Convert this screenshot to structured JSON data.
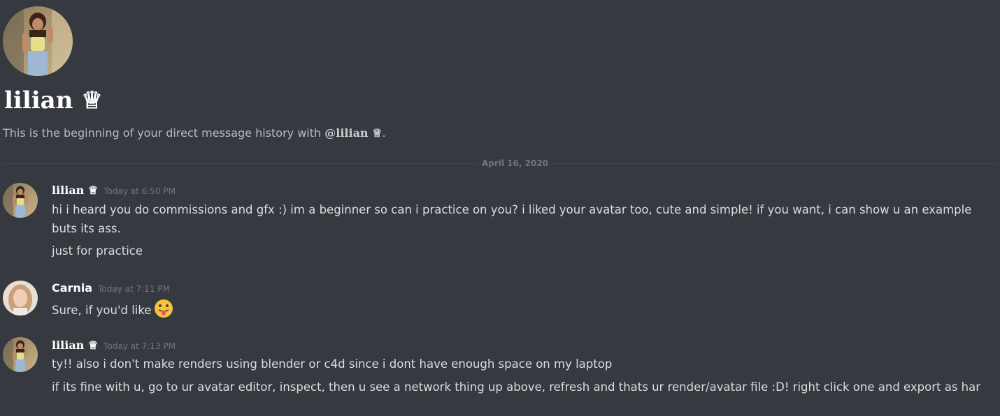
{
  "header": {
    "title": "lilian ♕",
    "intro_prefix": "This is the beginning of your direct message history with ",
    "intro_mention": "@lilian ♕",
    "intro_suffix": "."
  },
  "divider": {
    "date": "April 16, 2020"
  },
  "messages": [
    {
      "author": "lilian ♕",
      "timestamp": "Today at 6:50 PM",
      "lines": [
        "hi i heard you do commissions and gfx :) im a beginner so can i practice on you? i liked your avatar too, cute and simple! if you want, i can show u an example buts its ass.",
        "just for practice"
      ]
    },
    {
      "author": "Carnia",
      "timestamp": "Today at 7:11 PM",
      "lines": [
        "Sure, if you'd like"
      ],
      "emoji": "tongue-out-emoji"
    },
    {
      "author": "lilian ♕",
      "timestamp": "Today at 7:13 PM",
      "lines": [
        "ty!! also i don't make renders using blender or c4d since i dont have enough space on my laptop",
        "if its fine with u, go to ur avatar editor, inspect, then u see a network thing up above, refresh and thats ur render/avatar file :D! right click one and export as har"
      ]
    }
  ],
  "colors": {
    "background": "#36393f",
    "text": "#dcddde",
    "muted": "#72767d",
    "author": "#ffffff"
  }
}
